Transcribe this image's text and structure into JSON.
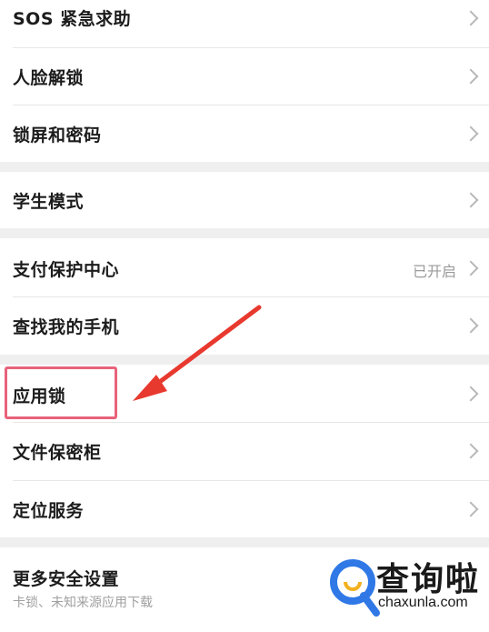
{
  "groups": [
    {
      "items": [
        {
          "label": "SOS 紧急求助"
        },
        {
          "label": "人脸解锁"
        },
        {
          "label": "锁屏和密码"
        }
      ]
    },
    {
      "items": [
        {
          "label": "学生模式"
        }
      ]
    },
    {
      "items": [
        {
          "label": "支付保护中心",
          "status": "已开启"
        },
        {
          "label": "查找我的手机"
        }
      ]
    },
    {
      "items": [
        {
          "label": "应用锁"
        },
        {
          "label": "文件保密柜"
        },
        {
          "label": "定位服务"
        }
      ]
    },
    {
      "items": [
        {
          "label": "更多安全设置",
          "subtitle": "卡锁、未知来源应用下载"
        }
      ]
    }
  ],
  "watermark": {
    "brand": "查询啦",
    "url": "chaxunla.com"
  },
  "colors": {
    "highlight": "#e8627a",
    "arrow": "#e8392f",
    "logo_blue": "#2f78e6"
  }
}
